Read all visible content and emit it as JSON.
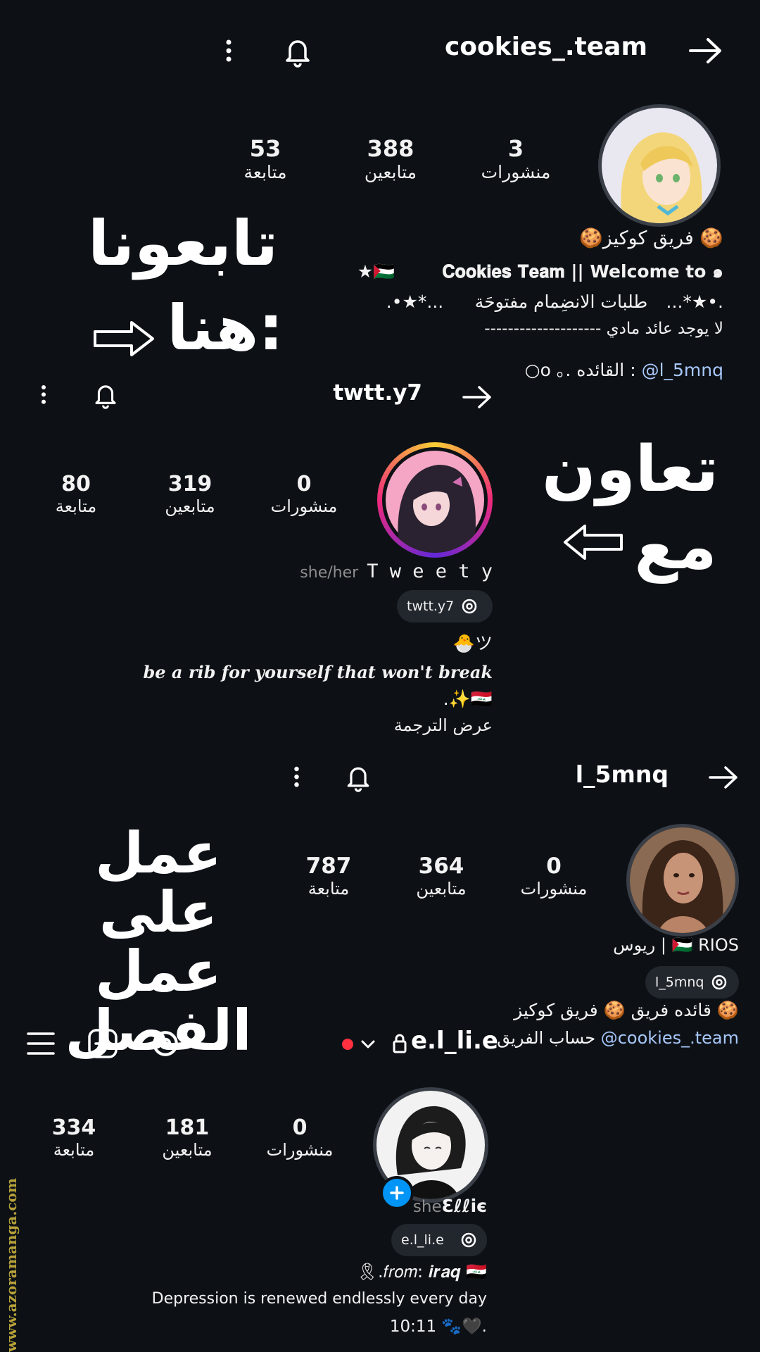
{
  "p1": {
    "username": "cookies_.team",
    "stats": [
      {
        "value": "3",
        "label": "منشورات"
      },
      {
        "value": "388",
        "label": "متابعين"
      },
      {
        "value": "53",
        "label": "متابعة"
      }
    ],
    "name": "🍪فريق كوكيز 🍪",
    "bio1": "★🇵🇸 ⠀⠀⠀𝐂𝐨𝐨𝐤𝐢𝐞𝐬 𝐓𝐞𝐚𝐦 || Welcome to ๑",
    "bio2": ".•★*...⠀⠀ طلبات الانضِمام مفتوحَة⠀ ...*★•.",
    "bio3": "-------------------- لا يوجد عائد مادي",
    "bio4_text": "○o ｡. القائده : ",
    "bio4_link": "@l_5mnq",
    "overlay": [
      "تابعونا",
      "هنا:"
    ]
  },
  "p2": {
    "username": "twtt.y7",
    "stats": [
      {
        "value": "0",
        "label": "منشورات"
      },
      {
        "value": "319",
        "label": "متابعين"
      },
      {
        "value": "80",
        "label": "متابعة"
      }
    ],
    "name": "T w e e t y",
    "pronouns": "she/her",
    "threads": "twtt.y7",
    "bio1": "🐣ツ",
    "bio2": "be a rib for yourself that won't break",
    "bio3": ".✨🇮🇶",
    "translate": "عرض الترجمة",
    "overlay": [
      "تعاون",
      "مع"
    ]
  },
  "p3": {
    "username": "l_5mnq",
    "stats": [
      {
        "value": "0",
        "label": "منشورات"
      },
      {
        "value": "364",
        "label": "متابعين"
      },
      {
        "value": "787",
        "label": "متابعة"
      }
    ],
    "name": "ريوس | 🇵🇸 RIOS",
    "threads": "l_5mnq",
    "bio1": "قائده فريق 🍪 فريق كوكيز 🍪",
    "bio2_text": "حساب الفريق ",
    "bio2_link": "@cookies_.team",
    "overlay": [
      "عمل على",
      "عمل الفصل"
    ]
  },
  "p4": {
    "username": "e.l_li.e",
    "stats": [
      {
        "value": "0",
        "label": "منشورات"
      },
      {
        "value": "181",
        "label": "متابعين"
      },
      {
        "value": "334",
        "label": "متابعة"
      }
    ],
    "name_prefix": "she",
    "name": "Ɛℓℓiє",
    "threads": "e.l_li.e",
    "bio1": "🎗.𝑓𝑟𝑜𝑚: 𝒊𝒓𝒂𝒒 🇮🇶",
    "bio2": "Depression is renewed endlessly every day",
    "bio3": "10:11 🐾🖤."
  },
  "watermark": "www.azoramanga.com",
  "colors": {
    "background": "#0d1116",
    "link": "#a8c7fa",
    "add_badge": "#0095f6",
    "live_dot": "#ff3040"
  }
}
